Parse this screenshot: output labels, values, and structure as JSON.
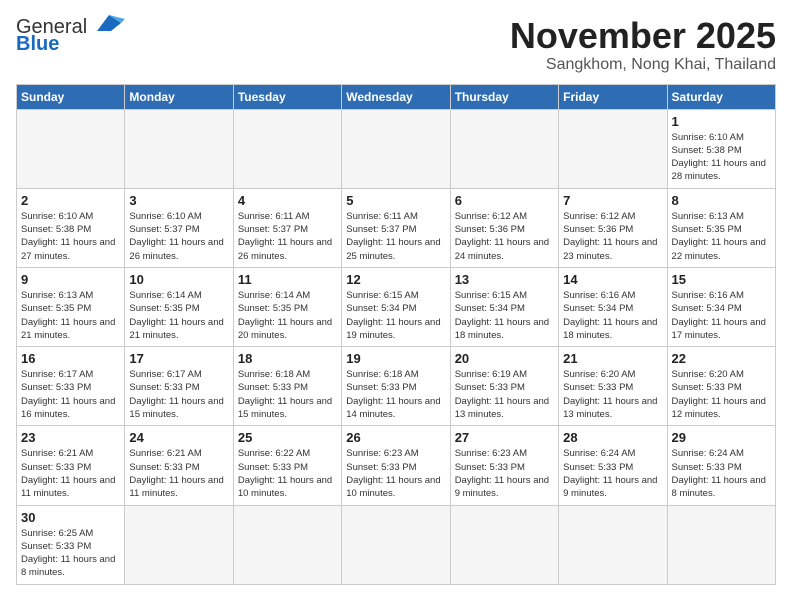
{
  "header": {
    "logo_general": "General",
    "logo_blue": "Blue",
    "month_title": "November 2025",
    "subtitle": "Sangkhom, Nong Khai, Thailand"
  },
  "weekdays": [
    "Sunday",
    "Monday",
    "Tuesday",
    "Wednesday",
    "Thursday",
    "Friday",
    "Saturday"
  ],
  "weeks": [
    [
      {
        "day": "",
        "info": ""
      },
      {
        "day": "",
        "info": ""
      },
      {
        "day": "",
        "info": ""
      },
      {
        "day": "",
        "info": ""
      },
      {
        "day": "",
        "info": ""
      },
      {
        "day": "",
        "info": ""
      },
      {
        "day": "1",
        "info": "Sunrise: 6:10 AM\nSunset: 5:38 PM\nDaylight: 11 hours\nand 28 minutes."
      }
    ],
    [
      {
        "day": "2",
        "info": "Sunrise: 6:10 AM\nSunset: 5:38 PM\nDaylight: 11 hours\nand 27 minutes."
      },
      {
        "day": "3",
        "info": "Sunrise: 6:10 AM\nSunset: 5:37 PM\nDaylight: 11 hours\nand 26 minutes."
      },
      {
        "day": "4",
        "info": "Sunrise: 6:11 AM\nSunset: 5:37 PM\nDaylight: 11 hours\nand 26 minutes."
      },
      {
        "day": "5",
        "info": "Sunrise: 6:11 AM\nSunset: 5:37 PM\nDaylight: 11 hours\nand 25 minutes."
      },
      {
        "day": "6",
        "info": "Sunrise: 6:12 AM\nSunset: 5:36 PM\nDaylight: 11 hours\nand 24 minutes."
      },
      {
        "day": "7",
        "info": "Sunrise: 6:12 AM\nSunset: 5:36 PM\nDaylight: 11 hours\nand 23 minutes."
      },
      {
        "day": "8",
        "info": "Sunrise: 6:13 AM\nSunset: 5:35 PM\nDaylight: 11 hours\nand 22 minutes."
      }
    ],
    [
      {
        "day": "9",
        "info": "Sunrise: 6:13 AM\nSunset: 5:35 PM\nDaylight: 11 hours\nand 21 minutes."
      },
      {
        "day": "10",
        "info": "Sunrise: 6:14 AM\nSunset: 5:35 PM\nDaylight: 11 hours\nand 21 minutes."
      },
      {
        "day": "11",
        "info": "Sunrise: 6:14 AM\nSunset: 5:35 PM\nDaylight: 11 hours\nand 20 minutes."
      },
      {
        "day": "12",
        "info": "Sunrise: 6:15 AM\nSunset: 5:34 PM\nDaylight: 11 hours\nand 19 minutes."
      },
      {
        "day": "13",
        "info": "Sunrise: 6:15 AM\nSunset: 5:34 PM\nDaylight: 11 hours\nand 18 minutes."
      },
      {
        "day": "14",
        "info": "Sunrise: 6:16 AM\nSunset: 5:34 PM\nDaylight: 11 hours\nand 18 minutes."
      },
      {
        "day": "15",
        "info": "Sunrise: 6:16 AM\nSunset: 5:34 PM\nDaylight: 11 hours\nand 17 minutes."
      }
    ],
    [
      {
        "day": "16",
        "info": "Sunrise: 6:17 AM\nSunset: 5:33 PM\nDaylight: 11 hours\nand 16 minutes."
      },
      {
        "day": "17",
        "info": "Sunrise: 6:17 AM\nSunset: 5:33 PM\nDaylight: 11 hours\nand 15 minutes."
      },
      {
        "day": "18",
        "info": "Sunrise: 6:18 AM\nSunset: 5:33 PM\nDaylight: 11 hours\nand 15 minutes."
      },
      {
        "day": "19",
        "info": "Sunrise: 6:18 AM\nSunset: 5:33 PM\nDaylight: 11 hours\nand 14 minutes."
      },
      {
        "day": "20",
        "info": "Sunrise: 6:19 AM\nSunset: 5:33 PM\nDaylight: 11 hours\nand 13 minutes."
      },
      {
        "day": "21",
        "info": "Sunrise: 6:20 AM\nSunset: 5:33 PM\nDaylight: 11 hours\nand 13 minutes."
      },
      {
        "day": "22",
        "info": "Sunrise: 6:20 AM\nSunset: 5:33 PM\nDaylight: 11 hours\nand 12 minutes."
      }
    ],
    [
      {
        "day": "23",
        "info": "Sunrise: 6:21 AM\nSunset: 5:33 PM\nDaylight: 11 hours\nand 11 minutes."
      },
      {
        "day": "24",
        "info": "Sunrise: 6:21 AM\nSunset: 5:33 PM\nDaylight: 11 hours\nand 11 minutes."
      },
      {
        "day": "25",
        "info": "Sunrise: 6:22 AM\nSunset: 5:33 PM\nDaylight: 11 hours\nand 10 minutes."
      },
      {
        "day": "26",
        "info": "Sunrise: 6:23 AM\nSunset: 5:33 PM\nDaylight: 11 hours\nand 10 minutes."
      },
      {
        "day": "27",
        "info": "Sunrise: 6:23 AM\nSunset: 5:33 PM\nDaylight: 11 hours\nand 9 minutes."
      },
      {
        "day": "28",
        "info": "Sunrise: 6:24 AM\nSunset: 5:33 PM\nDaylight: 11 hours\nand 9 minutes."
      },
      {
        "day": "29",
        "info": "Sunrise: 6:24 AM\nSunset: 5:33 PM\nDaylight: 11 hours\nand 8 minutes."
      }
    ],
    [
      {
        "day": "30",
        "info": "Sunrise: 6:25 AM\nSunset: 5:33 PM\nDaylight: 11 hours\nand 8 minutes."
      },
      {
        "day": "",
        "info": ""
      },
      {
        "day": "",
        "info": ""
      },
      {
        "day": "",
        "info": ""
      },
      {
        "day": "",
        "info": ""
      },
      {
        "day": "",
        "info": ""
      },
      {
        "day": "",
        "info": ""
      }
    ]
  ]
}
